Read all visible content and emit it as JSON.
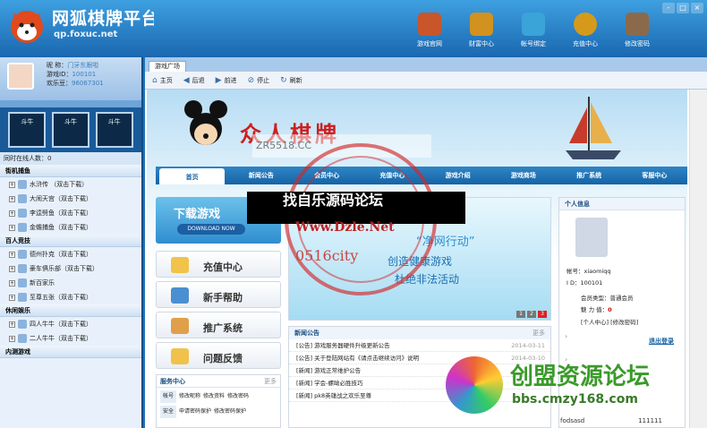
{
  "app": {
    "title": "网狐棋牌平台",
    "url": "qp.foxuc.net"
  },
  "window_controls": [
    "-",
    "□",
    "×"
  ],
  "topnav": [
    {
      "label": "游戏官网",
      "icon": "home-icon",
      "color": "#c9552b"
    },
    {
      "label": "财富中心",
      "icon": "treasure-chest-icon",
      "color": "#d1921f"
    },
    {
      "label": "帐号绑定",
      "icon": "diamond-icon",
      "color": "#3aa3d8"
    },
    {
      "label": "充值中心",
      "icon": "coin-icon",
      "color": "#d59a1a"
    },
    {
      "label": "修改密码",
      "icon": "password-icon",
      "color": "#8a6a4a"
    }
  ],
  "user": {
    "nick_label": "昵 称：",
    "nick": "门牙东跟啦",
    "id_label": "游戏ID：",
    "id": "100101",
    "beans_label": "欢乐豆：",
    "beans": "96067301"
  },
  "game_thumbs": [
    "斗牛",
    "斗牛",
    "斗牛"
  ],
  "online": "同时在线人数：0",
  "game_list": [
    {
      "type": "cat",
      "label": "街机捕鱼"
    },
    {
      "type": "item",
      "label": "水浒传 （双击下载）"
    },
    {
      "type": "item",
      "label": "大闹天宫（双击下载）"
    },
    {
      "type": "item",
      "label": "李逵劈鱼（双击下载）"
    },
    {
      "type": "item",
      "label": "金蟾捕鱼（双击下载）"
    },
    {
      "type": "cat",
      "label": "百人竞技"
    },
    {
      "type": "item",
      "label": "德州扑克（双击下载）"
    },
    {
      "type": "item",
      "label": "豪车俱乐部（双击下载）"
    },
    {
      "type": "item",
      "label": "新百家乐"
    },
    {
      "type": "item",
      "label": "至尊五张（双击下载）"
    },
    {
      "type": "cat",
      "label": "休闲娱乐"
    },
    {
      "type": "item",
      "label": "四人牛牛（双击下载）"
    },
    {
      "type": "item",
      "label": "二人牛牛（双击下载）"
    },
    {
      "type": "cat",
      "label": "内测游戏"
    }
  ],
  "main_tab": "游戏广场",
  "toolbar": {
    "home": "主页",
    "back": "后退",
    "forward": "前进",
    "stop": "停止",
    "refresh": "刷新"
  },
  "site": {
    "title": "众人棋牌",
    "nav": [
      "首页",
      "新闻公告",
      "会员中心",
      "充值中心",
      "游戏介绍",
      "游戏商场",
      "推广系统",
      "客服中心"
    ],
    "download": {
      "title": "下载游戏",
      "button": "DOWNLOAD NOW"
    },
    "menu": [
      "充值中心",
      "新手帮助",
      "推广系统",
      "问题反馈"
    ],
    "service": {
      "title": "服务中心",
      "more": "更多",
      "rows": [
        {
          "tag": "帐号",
          "items": [
            "修改昵称",
            "修改资料",
            "修改密码"
          ]
        },
        {
          "tag": "安全",
          "items": [
            "申请密码保护",
            "修改密码保护"
          ]
        }
      ]
    },
    "banner": {
      "l1": "“净网行动”",
      "l2": "创造健康游戏",
      "l3": "杜绝非法活动",
      "pages": [
        "1",
        "2",
        "3"
      ]
    },
    "news": {
      "title": "新闻公告",
      "more": "更多",
      "rows": [
        {
          "text": "[公告] 游戏服务器硬件升级更新公告",
          "date": "2014-03-11"
        },
        {
          "text": "[公告] 关于登陆网站有《请点击继续访问》说明",
          "date": "2014-03-10"
        },
        {
          "text": "[新闻] 游戏正常维护公告",
          "date": ""
        },
        {
          "text": "[新闻] 学会-螺呦必胜技巧",
          "date": ""
        },
        {
          "text": "[新闻] pk8英雄战之欢乐至尊",
          "date": ""
        }
      ]
    },
    "personal": {
      "title": "个人信息",
      "account_label": "帐号：",
      "account": "xiaomiqq",
      "id_label": "I D：",
      "id": "100101",
      "type_label": "会员类型：",
      "type": "普通会员",
      "charm_label": "魅 力 值：",
      "charm": "0",
      "links": "[个人中心]  [修改密码]",
      "logout": "退出登录",
      "footer_name": "fodsasd",
      "footer_num": "111111"
    }
  },
  "watermarks": {
    "zr": "ZR5518.CC",
    "line": "找自乐源码论坛",
    "url": "Www.Dzle.Net",
    "code": "0516city",
    "cm_title": "创盟资源论坛",
    "cm_url": "bbs.cmzy168.com"
  }
}
